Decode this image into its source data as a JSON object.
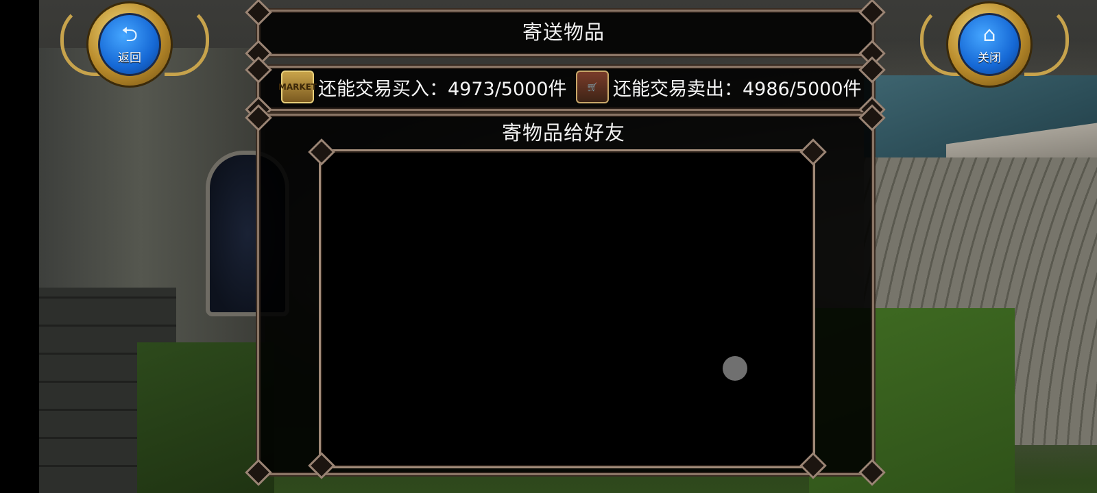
{
  "header": {
    "title": "寄送物品",
    "back_button": {
      "label": "返回",
      "icon": "back-arrow-icon"
    },
    "close_button": {
      "label": "关闭",
      "icon": "home-icon"
    }
  },
  "stats": {
    "buy": {
      "label": "还能交易买入：4973/5000件",
      "icon": "market-icon",
      "icon_text": "MARKET"
    },
    "sell": {
      "label": "还能交易卖出：4986/5000件",
      "icon": "shop-icon"
    }
  },
  "main": {
    "subtitle": "寄物品给好友"
  }
}
